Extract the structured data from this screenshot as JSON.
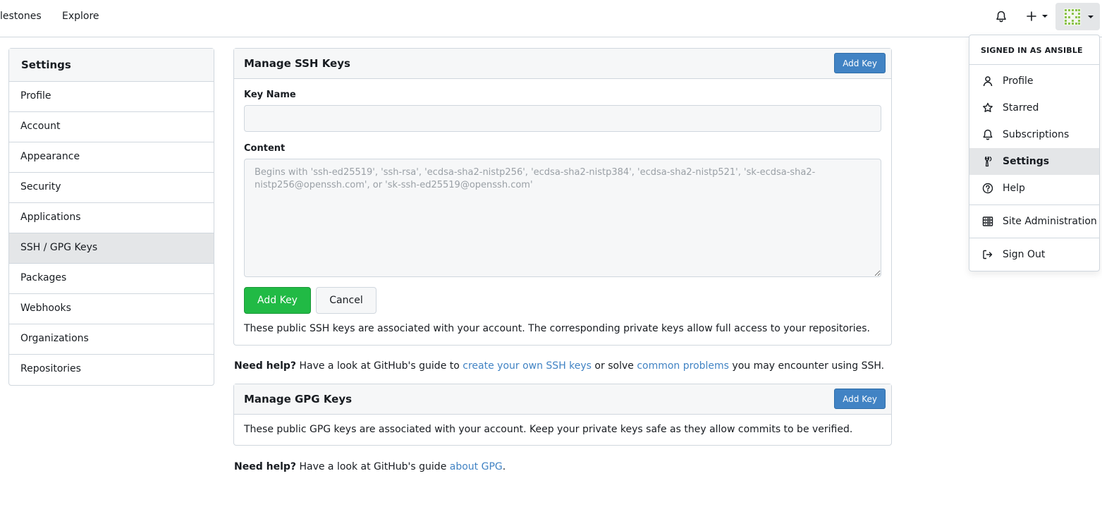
{
  "nav": {
    "links": [
      {
        "label": "lestones"
      },
      {
        "label": "Explore"
      }
    ]
  },
  "sidebar": {
    "title": "Settings",
    "items": [
      {
        "label": "Profile"
      },
      {
        "label": "Account"
      },
      {
        "label": "Appearance"
      },
      {
        "label": "Security"
      },
      {
        "label": "Applications"
      },
      {
        "label": "SSH / GPG Keys",
        "active": true
      },
      {
        "label": "Packages"
      },
      {
        "label": "Webhooks"
      },
      {
        "label": "Organizations"
      },
      {
        "label": "Repositories"
      }
    ]
  },
  "ssh": {
    "title": "Manage SSH Keys",
    "add_key_header": "Add Key",
    "key_name_label": "Key Name",
    "key_name_value": "",
    "content_label": "Content",
    "content_placeholder": "Begins with 'ssh-ed25519', 'ssh-rsa', 'ecdsa-sha2-nistp256', 'ecdsa-sha2-nistp384', 'ecdsa-sha2-nistp521', 'sk-ecdsa-sha2-nistp256@openssh.com', or 'sk-ssh-ed25519@openssh.com'",
    "add_key_button": "Add Key",
    "cancel_button": "Cancel",
    "description": "These public SSH keys are associated with your account. The corresponding private keys allow full access to your repositories."
  },
  "ssh_help": {
    "bold": "Need help?",
    "t1": " Have a look at GitHub's guide to ",
    "link1": "create your own SSH keys",
    "t2": " or solve ",
    "link2": "common problems",
    "t3": " you may encounter using SSH."
  },
  "gpg": {
    "title": "Manage GPG Keys",
    "add_key_header": "Add Key",
    "description": "These public GPG keys are associated with your account. Keep your private keys safe as they allow commits to be verified."
  },
  "gpg_help": {
    "bold": "Need help?",
    "t1": " Have a look at GitHub's guide ",
    "link1": "about GPG",
    "t2": "."
  },
  "user_menu": {
    "header": "SIGNED IN AS ANSIBLE",
    "items": [
      {
        "label": "Profile",
        "icon": "person-icon"
      },
      {
        "label": "Starred",
        "icon": "star-icon"
      },
      {
        "label": "Subscriptions",
        "icon": "bell-icon"
      },
      {
        "label": "Settings",
        "icon": "tools-icon",
        "active": true
      },
      {
        "label": "Help",
        "icon": "question-icon"
      },
      {
        "label": "Site Administration",
        "icon": "server-icon"
      },
      {
        "label": "Sign Out",
        "icon": "sign-out-icon"
      }
    ]
  },
  "colors": {
    "accent": "#4183c4",
    "primary_green": "#21ba45",
    "active_bg": "#e4e6e8",
    "border": "#d0d7de",
    "avatar": "#8bc34a"
  }
}
